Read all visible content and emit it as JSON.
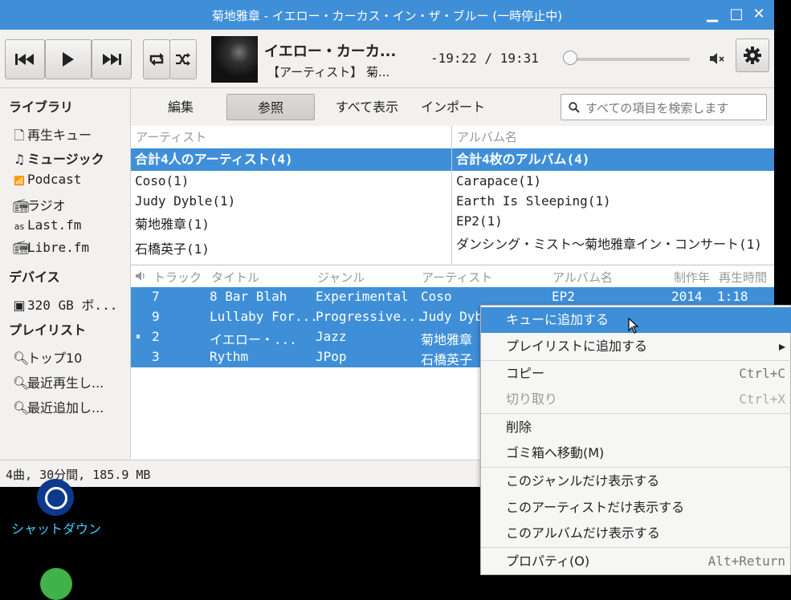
{
  "window": {
    "title": "菊地雅章 - イエロー・カーカス・イン・ザ・ブルー (一時停止中)"
  },
  "now_playing": {
    "title": "イエロー・カーカ...",
    "artist": "【アーティスト】 菊...",
    "time": "-19:22 / 19:31",
    "position_fraction": 0.0
  },
  "sidebar": {
    "library_heading": "ライブラリ",
    "library_items": [
      {
        "label": "再生キュー",
        "icon": "document-icon"
      },
      {
        "label": "ミュージック",
        "icon": "music-note-icon"
      },
      {
        "label": "Podcast",
        "icon": "podcast-icon"
      },
      {
        "label": "ラジオ",
        "icon": "radio-icon"
      },
      {
        "label": "Last.fm",
        "icon": "lastfm-icon"
      },
      {
        "label": "Libre.fm",
        "icon": "librefm-icon"
      }
    ],
    "devices_heading": "デバイス",
    "device_items": [
      {
        "label": "320 GB ボ...",
        "icon": "drive-icon"
      }
    ],
    "playlists_heading": "プレイリスト",
    "playlist_items": [
      {
        "label": "トップ10",
        "icon": "search-icon"
      },
      {
        "label": "最近再生し...",
        "icon": "search-icon"
      },
      {
        "label": "最近追加し...",
        "icon": "search-icon"
      }
    ],
    "buttons": {
      "add": "+",
      "remove": "−",
      "eject": "⏏"
    }
  },
  "browser_tabs": [
    "編集",
    "参照",
    "すべて表示",
    "インポート"
  ],
  "search": {
    "placeholder": "すべての項目を検索します"
  },
  "filters": {
    "artist_header": "アーティスト",
    "album_header": "アルバム名",
    "artists": [
      "合計4人のアーティスト(4)",
      "Coso(1)",
      "Judy Dyble(1)",
      "菊地雅章(1)",
      "石橋英子(1)"
    ],
    "albums": [
      "合計4枚のアルバム(4)",
      "Carapace(1)",
      "Earth Is Sleeping(1)",
      "EP2(1)",
      "ダンシング・ミスト〜菊地雅章イン・コンサート(1)"
    ]
  },
  "tracks": {
    "headers": [
      "トラック",
      "タイトル",
      "ジャンル",
      "アーティスト",
      "アルバム名",
      "制作年",
      "再生時間"
    ],
    "rows": [
      {
        "status": "",
        "track": "7",
        "title": "8 Bar Blah",
        "genre": "Experimental",
        "artist": "Coso",
        "album": "EP2",
        "year": "2014",
        "length": "1:18"
      },
      {
        "status": "",
        "track": "9",
        "title": "Lullaby For...",
        "genre": "Progressive...",
        "artist": "Judy Dyb",
        "album": "",
        "year": "",
        "length": ""
      },
      {
        "status": "⏸",
        "track": "2",
        "title": "イエロー・...",
        "genre": "Jazz",
        "artist": "菊地雅章",
        "album": "",
        "year": "",
        "length": ""
      },
      {
        "status": "",
        "track": "3",
        "title": "Rythm",
        "genre": "JPop",
        "artist": "石橋英子",
        "album": "",
        "year": "",
        "length": ""
      }
    ]
  },
  "status_bar": {
    "text": "4曲, 30分間, 185.9 MB"
  },
  "desktop": {
    "shutdown_label": "シャットダウン"
  },
  "context_menu": {
    "items": [
      {
        "label": "キューに追加する",
        "accel": "",
        "state": "highlighted"
      },
      {
        "label": "プレイリストに追加する",
        "accel": "▸",
        "state": "normal"
      },
      {
        "label": "コピー",
        "accel": "Ctrl+C",
        "state": "normal"
      },
      {
        "label": "切り取り",
        "accel": "Ctrl+X",
        "state": "disabled"
      },
      {
        "label": "削除",
        "accel": "",
        "state": "normal"
      },
      {
        "label": "ゴミ箱へ移動(M)",
        "accel": "",
        "state": "normal"
      },
      {
        "label": "このジャンルだけ表示する",
        "accel": "",
        "state": "normal"
      },
      {
        "label": "このアーティストだけ表示する",
        "accel": "",
        "state": "normal"
      },
      {
        "label": "このアルバムだけ表示する",
        "accel": "",
        "state": "normal"
      },
      {
        "label": "プロパティ(O)",
        "accel": "Alt+Return",
        "state": "normal"
      }
    ]
  },
  "colors": {
    "accent": "#3f8fd8",
    "titlebar": "#3f8fd8",
    "desktop": "#000000"
  }
}
